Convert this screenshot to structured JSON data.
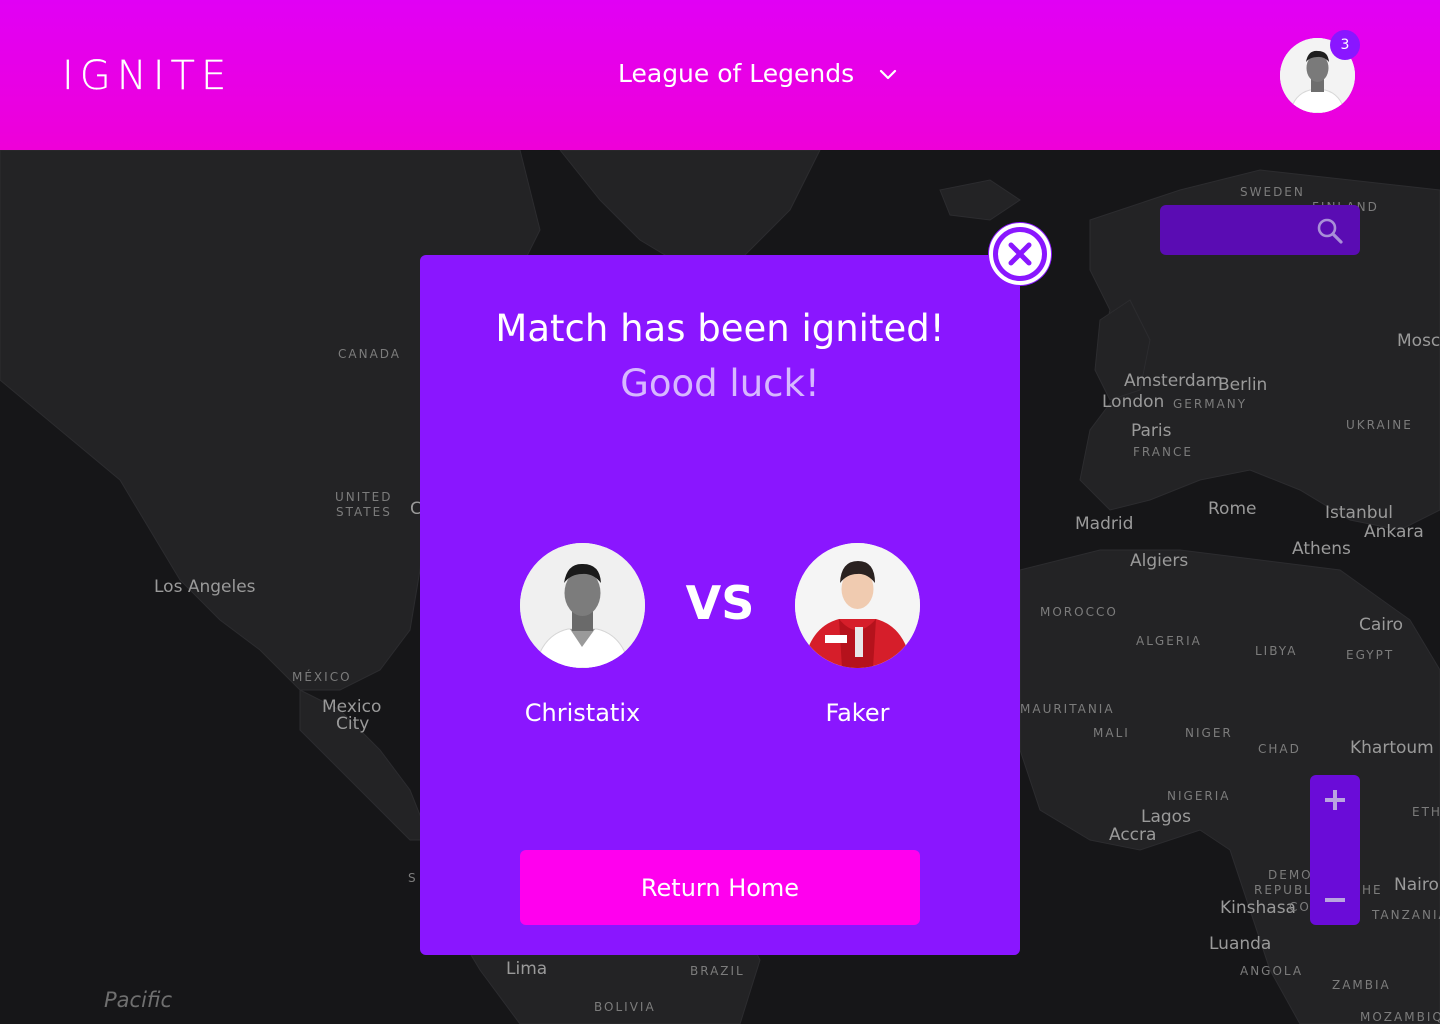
{
  "header": {
    "logo": "IGNITE",
    "game_select": {
      "selected": "League of Legends"
    },
    "notifications_count": "3"
  },
  "map": {
    "cities": [
      "Los Angeles",
      "Mexico",
      "City",
      "Amsterdam",
      "Berlin",
      "London",
      "Paris",
      "Madrid",
      "Rome",
      "Istanbul",
      "Ankara",
      "Athens",
      "Algiers",
      "Cairo",
      "Khartoum",
      "Lagos",
      "Accra",
      "Kinshasa",
      "Luanda",
      "Nairob",
      "Mosco",
      "Lima"
    ],
    "countries": [
      "CANADA",
      "UNITED",
      "STATES",
      "MÉXICO",
      "SWEDEN",
      "FINLAND",
      "GERMANY",
      "FRANCE",
      "UKRAINE",
      "MOROCCO",
      "ALGERIA",
      "LIBYA",
      "EGYPT",
      "MAURITANIA",
      "MALI",
      "NIGER",
      "CHAD",
      "NIGERIA",
      "DEMO",
      "REPUBLI",
      "CO",
      "TANZANIA",
      "ANGOLA",
      "ZAMBIA",
      "MOZAMBIQ",
      "BRAZIL",
      "BOLIVIA",
      "ETH",
      "HE"
    ],
    "fragments": [
      "C",
      "S"
    ],
    "ocean": "Pacific"
  },
  "modal": {
    "title": "Match has been ignited!",
    "subtitle": "Good luck!",
    "vs_label": "VS",
    "player_left": {
      "name": "Christatix"
    },
    "player_right": {
      "name": "Faker"
    },
    "return_button": "Return Home"
  },
  "colors": {
    "header": "#ee00e0",
    "modal": "#8a16ff",
    "button": "#ff00ee",
    "map_bg": "#161618"
  }
}
